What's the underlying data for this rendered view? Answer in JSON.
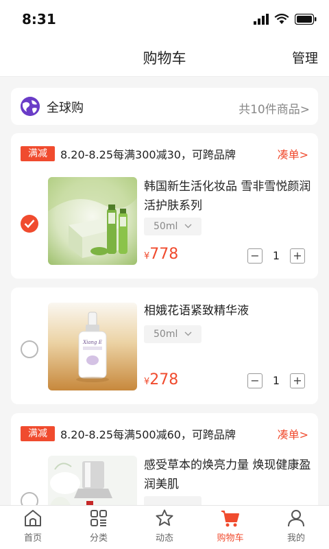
{
  "status_bar": {
    "time": "8:31"
  },
  "header": {
    "title": "购物车",
    "manage_label": "管理"
  },
  "global_buy": {
    "label": "全球购",
    "count_text": "共10件商品>"
  },
  "colors": {
    "accent": "#f04b2e",
    "global_logo": "#6a3cc7"
  },
  "groups": [
    {
      "promo": {
        "tag": "满减",
        "text": "8.20-8.25每满300减30，可跨品牌",
        "link": "凑单>"
      },
      "items": [
        {
          "name": "韩国新生活化妆品 雪非雪悦颜润活护肤系列",
          "spec": "50ml",
          "price_symbol": "¥",
          "price": "778",
          "quantity": "1",
          "checked": true
        }
      ]
    },
    {
      "promo": null,
      "items": [
        {
          "name": "相娥花语紧致精华液",
          "spec": "50ml",
          "price_symbol": "¥",
          "price": "278",
          "quantity": "1",
          "checked": false,
          "product_label": "Xiang E"
        }
      ]
    },
    {
      "promo": {
        "tag": "满减",
        "text": "8.20-8.25每满500减60，可跨品牌",
        "link": "凑单>"
      },
      "items": [
        {
          "name": "感受草本的焕亮力量 焕现健康盈润美肌",
          "checked": false
        }
      ]
    }
  ],
  "tabbar": {
    "tabs": [
      {
        "label": "首页",
        "icon": "home-icon",
        "active": false
      },
      {
        "label": "分类",
        "icon": "category-icon",
        "active": false
      },
      {
        "label": "动态",
        "icon": "star-icon",
        "active": false
      },
      {
        "label": "购物车",
        "icon": "cart-icon",
        "active": true
      },
      {
        "label": "我的",
        "icon": "profile-icon",
        "active": false
      }
    ]
  }
}
